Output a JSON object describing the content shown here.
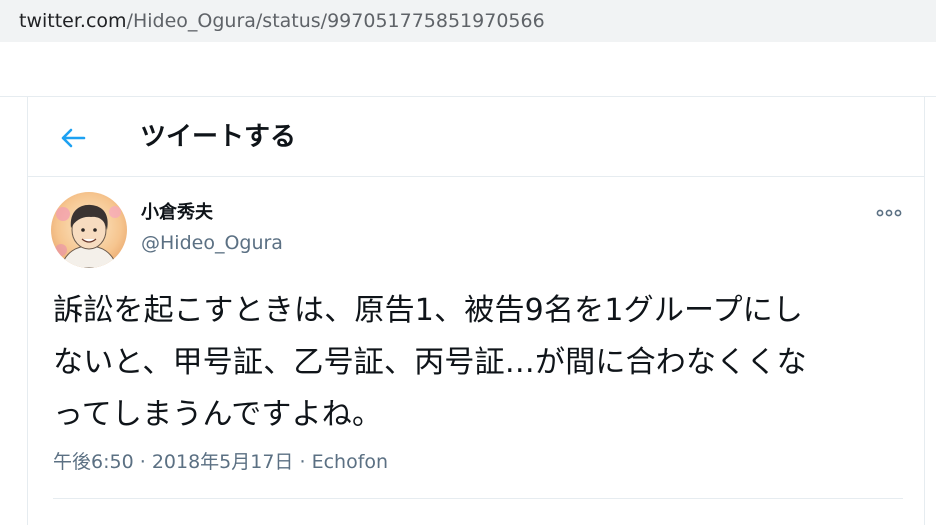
{
  "browser": {
    "url_host": "twitter.com",
    "url_path": "/Hideo_Ogura/status/997051775851970566"
  },
  "header": {
    "back_icon": "arrow-left-icon",
    "title": "ツイートする"
  },
  "tweet": {
    "author_name": "小倉秀夫",
    "author_handle": "@Hideo_Ogura",
    "more_icon": "more-options-icon",
    "lines": [
      "訴訟を起こすときは、原告1、被告9名を1グループにし",
      "ないと、甲号証、乙号証、丙号証…が間に合わなくくな",
      "ってしまうんですよね。"
    ],
    "time": "午後6:50",
    "date": "2018年5月17日",
    "source": "Echofon",
    "separator": "·"
  },
  "colors": {
    "accent": "#1da1f2",
    "secondary_text": "#5b7083",
    "border": "#e6ecf0",
    "urlbar": "#f1f3f4"
  }
}
